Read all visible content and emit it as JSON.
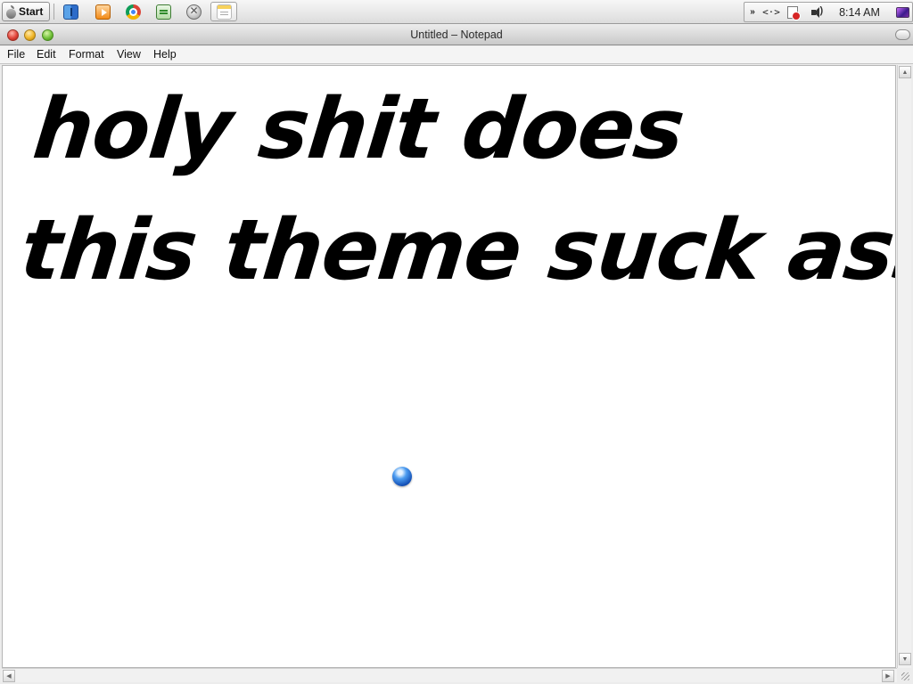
{
  "taskbar": {
    "start_label": "Start",
    "quick_launch": [
      {
        "icon": "finder-icon"
      },
      {
        "icon": "media-player-icon"
      },
      {
        "icon": "chrome-icon"
      },
      {
        "icon": "system-monitor-icon"
      },
      {
        "icon": "tools-icon"
      },
      {
        "icon": "notepad-icon"
      }
    ],
    "tray": {
      "chevron": "»",
      "code_glyph": "<·>",
      "clock": "8:14 AM"
    }
  },
  "window": {
    "title": "Untitled – Notepad",
    "menu": [
      "File",
      "Edit",
      "Format",
      "View",
      "Help"
    ]
  },
  "editor": {
    "text": "holy shit does\nthis theme suck ass"
  }
}
